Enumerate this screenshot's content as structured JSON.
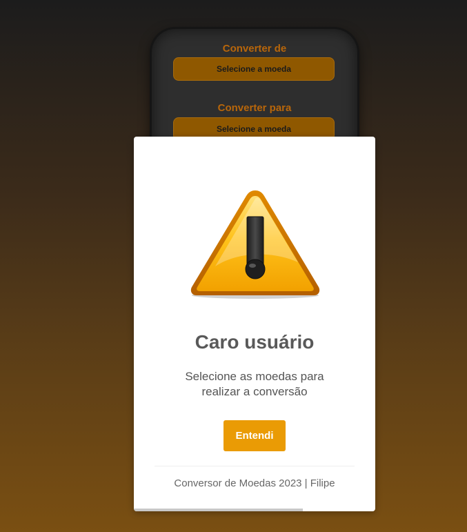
{
  "converter": {
    "from_label": "Converter de",
    "from_select": "Selecione a moeda",
    "to_label": "Converter para",
    "to_select": "Selecione a moeda"
  },
  "alert": {
    "icon": "warning-icon",
    "title": "Caro usuário",
    "text_line1": "Selecione as moedas para",
    "text_line2": "realizar a conversão",
    "confirm_label": "Entendi",
    "footer": "Conversor de Moedas 2023 | Filipe",
    "timer_progress": 0.7
  },
  "colors": {
    "accent": "#ea9b05",
    "select_bg": "#8f5800",
    "label": "#b8660a",
    "card_bg": "#2e2e2e"
  }
}
